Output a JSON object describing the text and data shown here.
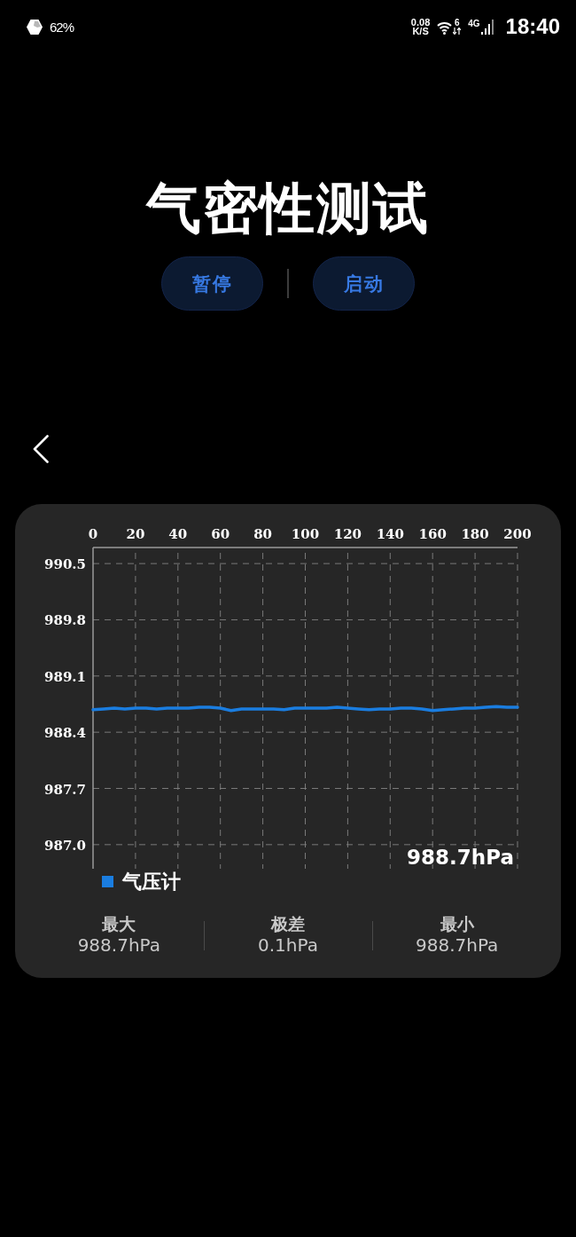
{
  "status_bar": {
    "battery": "62%",
    "network_speed": "0.08",
    "network_speed_unit": "K/S",
    "wifi_standard": "6",
    "network_type": "4G",
    "time": "18:40"
  },
  "title": "气密性测试",
  "buttons": [
    {
      "label": "暂停"
    },
    {
      "label": "启动"
    }
  ],
  "card": {
    "chart_data": {
      "type": "line",
      "grid": true,
      "x": [
        0,
        5,
        10,
        15,
        20,
        25,
        30,
        35,
        40,
        45,
        50,
        55,
        60,
        65,
        70,
        75,
        80,
        85,
        90,
        95,
        100,
        105,
        110,
        115,
        120,
        125,
        130,
        135,
        140,
        145,
        150,
        155,
        160,
        165,
        170,
        175,
        180,
        185,
        190,
        195,
        200
      ],
      "series": [
        {
          "name": "气压计",
          "color": "#1a7de0",
          "values": [
            988.68,
            988.69,
            988.7,
            988.69,
            988.7,
            988.7,
            988.69,
            988.7,
            988.7,
            988.7,
            988.71,
            988.71,
            988.7,
            988.67,
            988.69,
            988.69,
            988.69,
            988.69,
            988.68,
            988.7,
            988.7,
            988.7,
            988.7,
            988.71,
            988.7,
            988.69,
            988.68,
            988.69,
            988.69,
            988.7,
            988.7,
            988.69,
            988.67,
            988.68,
            988.69,
            988.7,
            988.7,
            988.71,
            988.72,
            988.71,
            988.71
          ]
        }
      ],
      "xlim": [
        0,
        200
      ],
      "ylim": [
        986.7,
        990.7
      ],
      "xticks": [
        0,
        20,
        40,
        60,
        80,
        100,
        120,
        140,
        160,
        180,
        200
      ],
      "yticks": [
        {
          "value": 987,
          "label": "987.0"
        },
        987.7,
        988.4,
        989.1,
        989.8,
        990.5
      ]
    },
    "current_reading": "988.7hPa",
    "stats": [
      {
        "label": "最大",
        "value": "988.7hPa"
      },
      {
        "label": "极差",
        "value": "0.1hPa"
      },
      {
        "label": "最小",
        "value": "988.7hPa"
      }
    ]
  }
}
